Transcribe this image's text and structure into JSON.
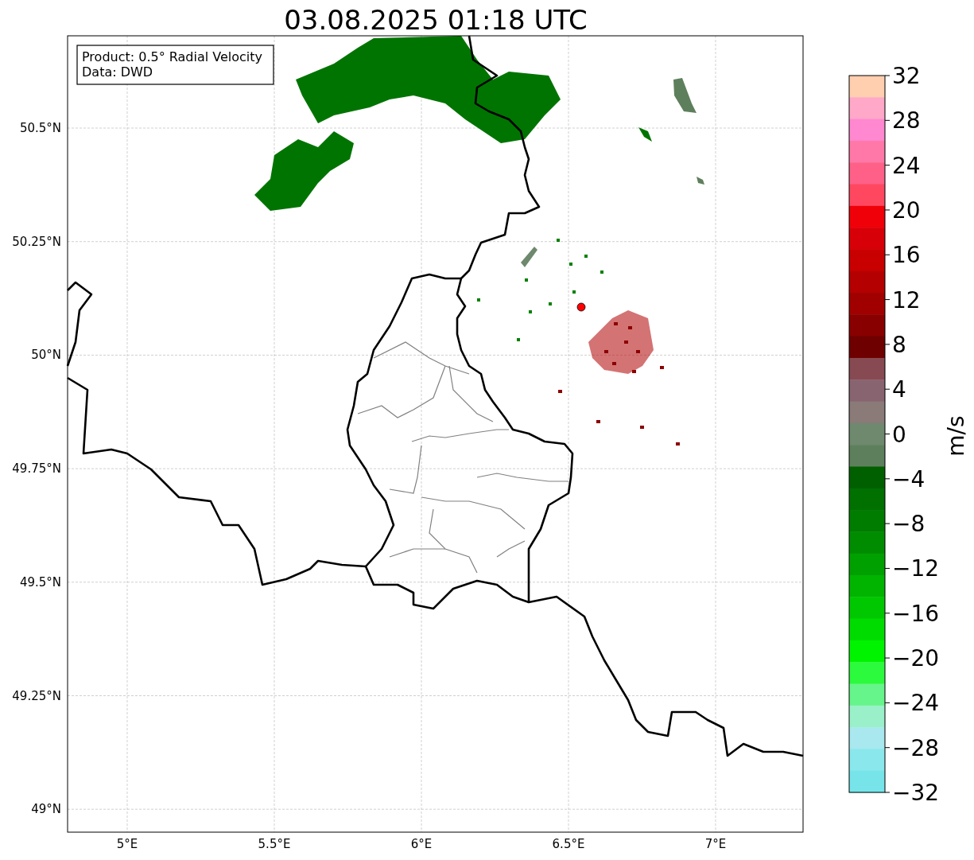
{
  "title": "03.08.2025 01:18 UTC",
  "info_box": [
    "Product: 0.5° Radial Velocity",
    "Data: DWD"
  ],
  "map": {
    "x_ticks": [
      "5°E",
      "5.5°E",
      "6°E",
      "6.5°E",
      "7°E"
    ],
    "y_ticks": [
      "50.5°N",
      "50.25°N",
      "50°N",
      "49.75°N",
      "49.5°N",
      "49.25°N",
      "49°N"
    ]
  },
  "colorbar": {
    "label": "m/s",
    "ticks": [
      "32",
      "28",
      "24",
      "20",
      "16",
      "12",
      "8",
      "4",
      "0",
      "−4",
      "−8",
      "−12",
      "−16",
      "−20",
      "−24",
      "−28",
      "−32"
    ],
    "bins": [
      {
        "color": "#ffcfb0"
      },
      {
        "color": "#ffa8c8"
      },
      {
        "color": "#ff88d0"
      },
      {
        "color": "#ff78a8"
      },
      {
        "color": "#ff6088"
      },
      {
        "color": "#ff4860"
      },
      {
        "color": "#f00008"
      },
      {
        "color": "#d80008"
      },
      {
        "color": "#c80000"
      },
      {
        "color": "#b40000"
      },
      {
        "color": "#a00000"
      },
      {
        "color": "#880000"
      },
      {
        "color": "#6e0000"
      },
      {
        "color": "#884a52"
      },
      {
        "color": "#886470"
      },
      {
        "color": "#8a7a78"
      },
      {
        "color": "#6e896e"
      },
      {
        "color": "#5e7f5c"
      },
      {
        "color": "#006000"
      },
      {
        "color": "#007000"
      },
      {
        "color": "#007c00"
      },
      {
        "color": "#008c00"
      },
      {
        "color": "#00a000"
      },
      {
        "color": "#00b400"
      },
      {
        "color": "#00c800"
      },
      {
        "color": "#00dc00"
      },
      {
        "color": "#00f400"
      },
      {
        "color": "#2cfa3c"
      },
      {
        "color": "#66f58a"
      },
      {
        "color": "#9af0c8"
      },
      {
        "color": "#a8e8ee"
      },
      {
        "color": "#8ae8ec"
      },
      {
        "color": "#76e4e8"
      }
    ]
  }
}
